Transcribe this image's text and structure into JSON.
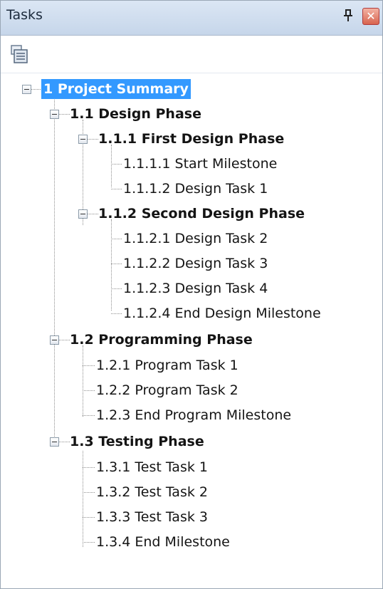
{
  "panel": {
    "title": "Tasks",
    "pin_glyph": "\u0002",
    "close_glyph": "✕"
  },
  "toolbar": {
    "icon": "task-list-icon"
  },
  "tree": {
    "n1": "1 Project Summary",
    "n1_1": "1.1 Design Phase",
    "n1_1_1": "1.1.1 First Design Phase",
    "n1_1_1_1": "1.1.1.1 Start Milestone",
    "n1_1_1_2": "1.1.1.2 Design Task 1",
    "n1_1_2": "1.1.2 Second Design Phase",
    "n1_1_2_1": "1.1.2.1 Design Task 2",
    "n1_1_2_2": "1.1.2.2 Design Task 3",
    "n1_1_2_3": "1.1.2.3 Design Task 4",
    "n1_1_2_4": "1.1.2.4 End Design Milestone",
    "n1_2": "1.2 Programming Phase",
    "n1_2_1": "1.2.1 Program Task 1",
    "n1_2_2": "1.2.2 Program Task 2",
    "n1_2_3": "1.2.3 End Program Milestone",
    "n1_3": "1.3 Testing Phase",
    "n1_3_1": "1.3.1 Test Task 1",
    "n1_3_2": "1.3.2 Test Task 2",
    "n1_3_3": "1.3.3 Test Task 3",
    "n1_3_4": "1.3.4 End Milestone"
  },
  "colors": {
    "selection": "#3399ff",
    "title_bar": "#c6d6ea"
  }
}
